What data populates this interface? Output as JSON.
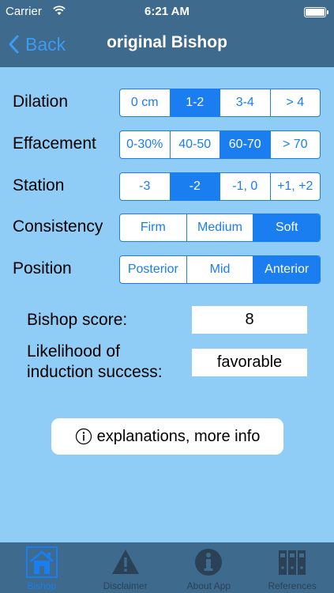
{
  "status": {
    "carrier": "Carrier",
    "time": "6:21 AM"
  },
  "nav": {
    "back_label": "Back",
    "title": "original Bishop"
  },
  "rows": [
    {
      "label": "Dilation",
      "options": [
        "0 cm",
        "1-2",
        "3-4",
        "> 4"
      ],
      "selected": "1-2"
    },
    {
      "label": "Effacement",
      "options": [
        "0-30%",
        "40-50",
        "60-70",
        "> 70"
      ],
      "selected": "60-70"
    },
    {
      "label": "Station",
      "options": [
        "-3",
        "-2",
        "-1, 0",
        "+1, +2"
      ],
      "selected": "-2"
    },
    {
      "label": "Consistency",
      "options": [
        "Firm",
        "Medium",
        "Soft"
      ],
      "selected": "Soft"
    },
    {
      "label": "Position",
      "options": [
        "Posterior",
        "Mid",
        "Anterior"
      ],
      "selected": "Anterior"
    }
  ],
  "results": {
    "score_label": "Bishop score:",
    "score_value": "8",
    "likelihood_label_line1": "Likelihood of",
    "likelihood_label_line2": "induction success:",
    "likelihood_value": "favorable"
  },
  "info_button": {
    "label": "explanations, more info"
  },
  "tabs": [
    {
      "label": "Bishop",
      "icon": "house-icon"
    },
    {
      "label": "Disclaimer",
      "icon": "warning-icon"
    },
    {
      "label": "About App",
      "icon": "info-icon"
    },
    {
      "label": "References",
      "icon": "binders-icon"
    }
  ],
  "colors": {
    "background": "#8fcdf6",
    "bar": "#3d6a8d",
    "accent": "#1a7ef0"
  }
}
